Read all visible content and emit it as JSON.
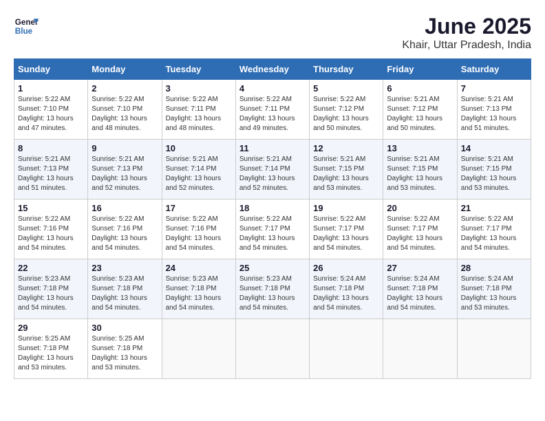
{
  "header": {
    "logo_line1": "General",
    "logo_line2": "Blue",
    "title": "June 2025",
    "subtitle": "Khair, Uttar Pradesh, India"
  },
  "weekdays": [
    "Sunday",
    "Monday",
    "Tuesday",
    "Wednesday",
    "Thursday",
    "Friday",
    "Saturday"
  ],
  "weeks": [
    [
      {
        "day": "1",
        "info": "Sunrise: 5:22 AM\nSunset: 7:10 PM\nDaylight: 13 hours\nand 47 minutes."
      },
      {
        "day": "2",
        "info": "Sunrise: 5:22 AM\nSunset: 7:10 PM\nDaylight: 13 hours\nand 48 minutes."
      },
      {
        "day": "3",
        "info": "Sunrise: 5:22 AM\nSunset: 7:11 PM\nDaylight: 13 hours\nand 48 minutes."
      },
      {
        "day": "4",
        "info": "Sunrise: 5:22 AM\nSunset: 7:11 PM\nDaylight: 13 hours\nand 49 minutes."
      },
      {
        "day": "5",
        "info": "Sunrise: 5:22 AM\nSunset: 7:12 PM\nDaylight: 13 hours\nand 50 minutes."
      },
      {
        "day": "6",
        "info": "Sunrise: 5:21 AM\nSunset: 7:12 PM\nDaylight: 13 hours\nand 50 minutes."
      },
      {
        "day": "7",
        "info": "Sunrise: 5:21 AM\nSunset: 7:13 PM\nDaylight: 13 hours\nand 51 minutes."
      }
    ],
    [
      {
        "day": "8",
        "info": "Sunrise: 5:21 AM\nSunset: 7:13 PM\nDaylight: 13 hours\nand 51 minutes."
      },
      {
        "day": "9",
        "info": "Sunrise: 5:21 AM\nSunset: 7:13 PM\nDaylight: 13 hours\nand 52 minutes."
      },
      {
        "day": "10",
        "info": "Sunrise: 5:21 AM\nSunset: 7:14 PM\nDaylight: 13 hours\nand 52 minutes."
      },
      {
        "day": "11",
        "info": "Sunrise: 5:21 AM\nSunset: 7:14 PM\nDaylight: 13 hours\nand 52 minutes."
      },
      {
        "day": "12",
        "info": "Sunrise: 5:21 AM\nSunset: 7:15 PM\nDaylight: 13 hours\nand 53 minutes."
      },
      {
        "day": "13",
        "info": "Sunrise: 5:21 AM\nSunset: 7:15 PM\nDaylight: 13 hours\nand 53 minutes."
      },
      {
        "day": "14",
        "info": "Sunrise: 5:21 AM\nSunset: 7:15 PM\nDaylight: 13 hours\nand 53 minutes."
      }
    ],
    [
      {
        "day": "15",
        "info": "Sunrise: 5:22 AM\nSunset: 7:16 PM\nDaylight: 13 hours\nand 54 minutes."
      },
      {
        "day": "16",
        "info": "Sunrise: 5:22 AM\nSunset: 7:16 PM\nDaylight: 13 hours\nand 54 minutes."
      },
      {
        "day": "17",
        "info": "Sunrise: 5:22 AM\nSunset: 7:16 PM\nDaylight: 13 hours\nand 54 minutes."
      },
      {
        "day": "18",
        "info": "Sunrise: 5:22 AM\nSunset: 7:17 PM\nDaylight: 13 hours\nand 54 minutes."
      },
      {
        "day": "19",
        "info": "Sunrise: 5:22 AM\nSunset: 7:17 PM\nDaylight: 13 hours\nand 54 minutes."
      },
      {
        "day": "20",
        "info": "Sunrise: 5:22 AM\nSunset: 7:17 PM\nDaylight: 13 hours\nand 54 minutes."
      },
      {
        "day": "21",
        "info": "Sunrise: 5:22 AM\nSunset: 7:17 PM\nDaylight: 13 hours\nand 54 minutes."
      }
    ],
    [
      {
        "day": "22",
        "info": "Sunrise: 5:23 AM\nSunset: 7:18 PM\nDaylight: 13 hours\nand 54 minutes."
      },
      {
        "day": "23",
        "info": "Sunrise: 5:23 AM\nSunset: 7:18 PM\nDaylight: 13 hours\nand 54 minutes."
      },
      {
        "day": "24",
        "info": "Sunrise: 5:23 AM\nSunset: 7:18 PM\nDaylight: 13 hours\nand 54 minutes."
      },
      {
        "day": "25",
        "info": "Sunrise: 5:23 AM\nSunset: 7:18 PM\nDaylight: 13 hours\nand 54 minutes."
      },
      {
        "day": "26",
        "info": "Sunrise: 5:24 AM\nSunset: 7:18 PM\nDaylight: 13 hours\nand 54 minutes."
      },
      {
        "day": "27",
        "info": "Sunrise: 5:24 AM\nSunset: 7:18 PM\nDaylight: 13 hours\nand 54 minutes."
      },
      {
        "day": "28",
        "info": "Sunrise: 5:24 AM\nSunset: 7:18 PM\nDaylight: 13 hours\nand 53 minutes."
      }
    ],
    [
      {
        "day": "29",
        "info": "Sunrise: 5:25 AM\nSunset: 7:18 PM\nDaylight: 13 hours\nand 53 minutes."
      },
      {
        "day": "30",
        "info": "Sunrise: 5:25 AM\nSunset: 7:18 PM\nDaylight: 13 hours\nand 53 minutes."
      },
      {
        "day": "",
        "info": ""
      },
      {
        "day": "",
        "info": ""
      },
      {
        "day": "",
        "info": ""
      },
      {
        "day": "",
        "info": ""
      },
      {
        "day": "",
        "info": ""
      }
    ]
  ]
}
